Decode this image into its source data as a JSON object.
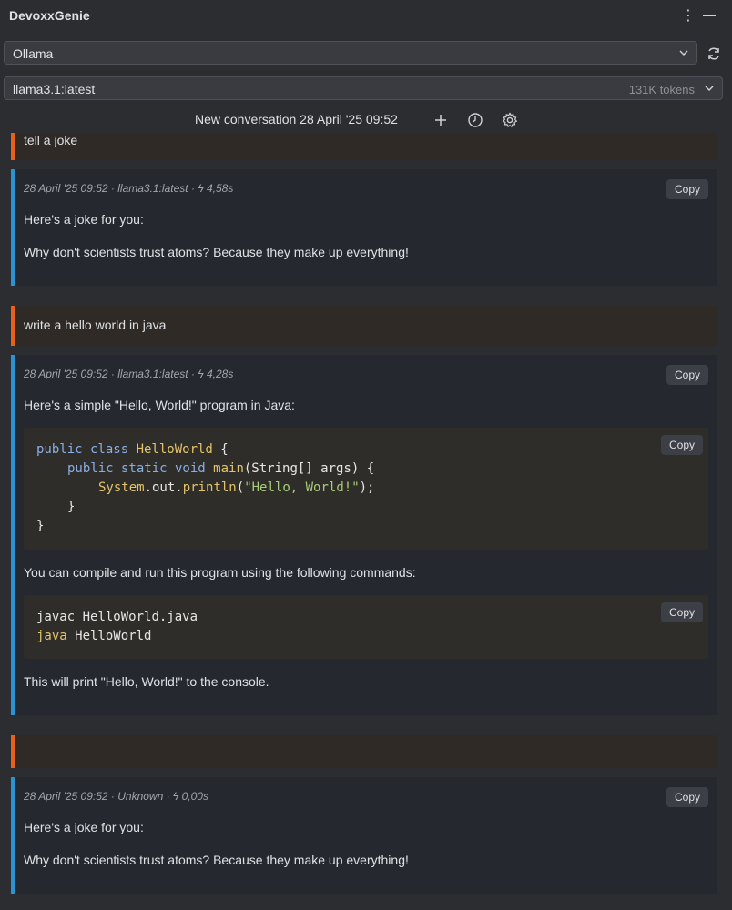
{
  "app": {
    "title": "DevoxxGenie"
  },
  "provider": {
    "selected": "Ollama"
  },
  "model": {
    "selected": "llama3.1:latest",
    "tokens": "131K tokens"
  },
  "conversation": {
    "title": "New conversation 28 April '25 09:52"
  },
  "messages": {
    "user1": {
      "text": "tell a joke"
    },
    "ai1": {
      "meta": "28 April '25 09:52 · llama3.1:latest · ϟ 4,58s",
      "p1": "Here's a joke for you:",
      "p2": "Why don't scientists trust atoms? Because they make up everything!",
      "copy": "Copy"
    },
    "user2": {
      "text": "write a hello world in java"
    },
    "ai2": {
      "meta": "28 April '25 09:52 · llama3.1:latest · ϟ 4,28s",
      "p1": "Here's a simple \"Hello, World!\" program in Java:",
      "copy": "Copy",
      "code1_copy": "Copy",
      "code1": {
        "l1_kw": "public class ",
        "l1_cls": "HelloWorld",
        "l1_rest": " {",
        "l2_kw": "public static void ",
        "l2_fn": "main",
        "l2_rest": "(String[] args) {",
        "l3_obj": "System",
        "l3_dot1": ".out.",
        "l3_fn": "println",
        "l3_open": "(",
        "l3_str": "\"Hello, World!\"",
        "l3_close": ");",
        "l4": "}",
        "l5": "}"
      },
      "p2": "You can compile and run this program using the following commands:",
      "code2_copy": "Copy",
      "code2": {
        "l1_cmd": "javac",
        "l1_rest": " HelloWorld.java",
        "l2_cmd": "java",
        "l2_rest": " HelloWorld"
      },
      "p3": "This will print \"Hello, World!\" to the console."
    },
    "user3": {
      "text": ""
    },
    "ai3": {
      "meta": "28 April '25 09:52 · Unknown · ϟ 0,00s",
      "p1": "Here's a joke for you:",
      "p2": "Why don't scientists trust atoms? Because they make up everything!",
      "copy": "Copy"
    }
  }
}
